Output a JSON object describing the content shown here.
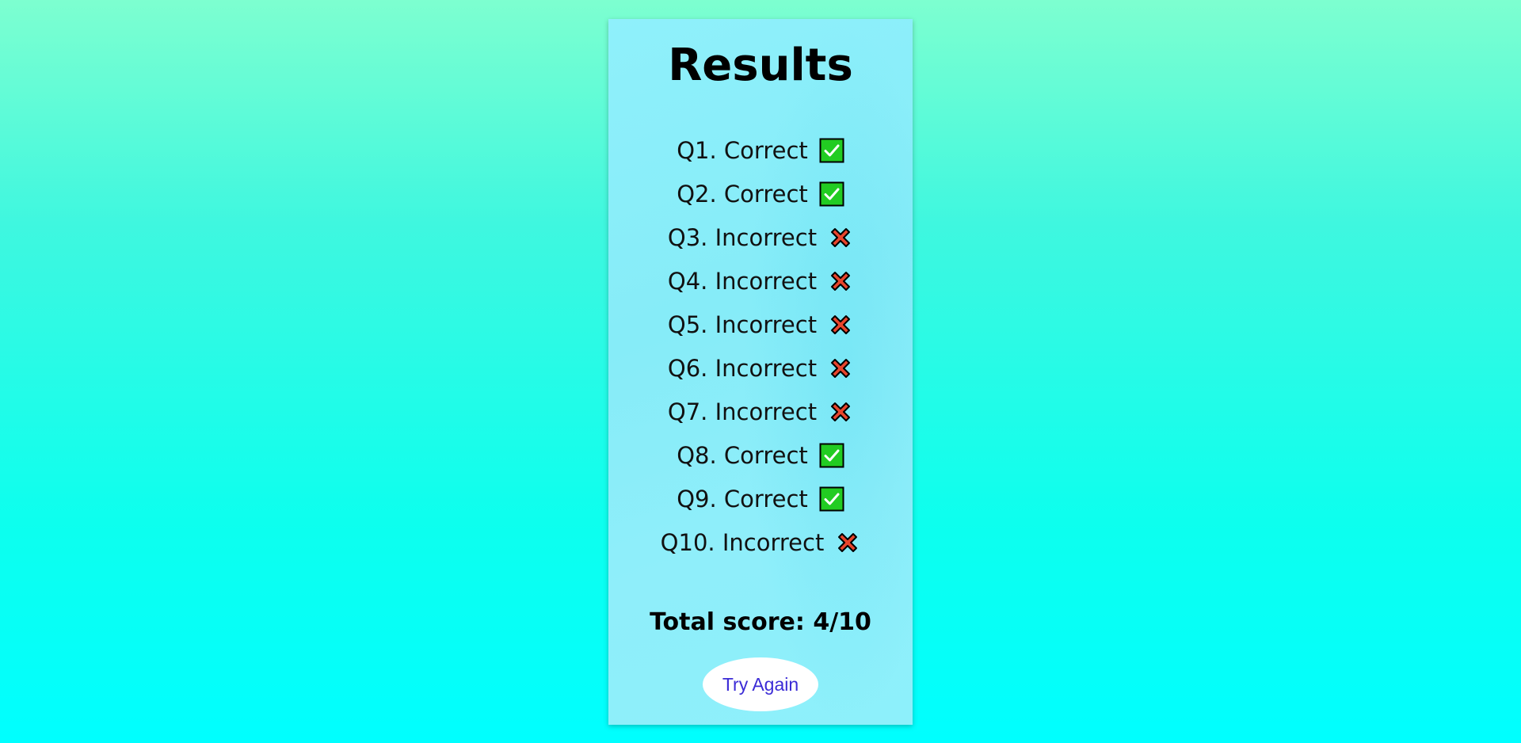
{
  "page": {
    "title": "Results"
  },
  "results": [
    {
      "label": "Q1. Correct",
      "status": "correct",
      "icon": "check-icon"
    },
    {
      "label": "Q2. Correct",
      "status": "correct",
      "icon": "check-icon"
    },
    {
      "label": "Q3. Incorrect",
      "status": "incorrect",
      "icon": "cross-icon"
    },
    {
      "label": "Q4. Incorrect",
      "status": "incorrect",
      "icon": "cross-icon"
    },
    {
      "label": "Q5. Incorrect",
      "status": "incorrect",
      "icon": "cross-icon"
    },
    {
      "label": "Q6. Incorrect",
      "status": "incorrect",
      "icon": "cross-icon"
    },
    {
      "label": "Q7. Incorrect",
      "status": "incorrect",
      "icon": "cross-icon"
    },
    {
      "label": "Q8. Correct",
      "status": "correct",
      "icon": "check-icon"
    },
    {
      "label": "Q9. Correct",
      "status": "correct",
      "icon": "check-icon"
    },
    {
      "label": "Q10. Incorrect",
      "status": "incorrect",
      "icon": "cross-icon"
    }
  ],
  "summary": {
    "total_label": "Total score: 4/10",
    "score": 4,
    "max": 10
  },
  "actions": {
    "try_again_label": "Try Again"
  },
  "colors": {
    "correct": "#22cc22",
    "incorrect": "#e8452c",
    "button_text": "#3b2bd6",
    "card_bg": "#8ff0fb",
    "page_bg_top": "#7dffd0",
    "page_bg_bottom": "#00ffff"
  }
}
